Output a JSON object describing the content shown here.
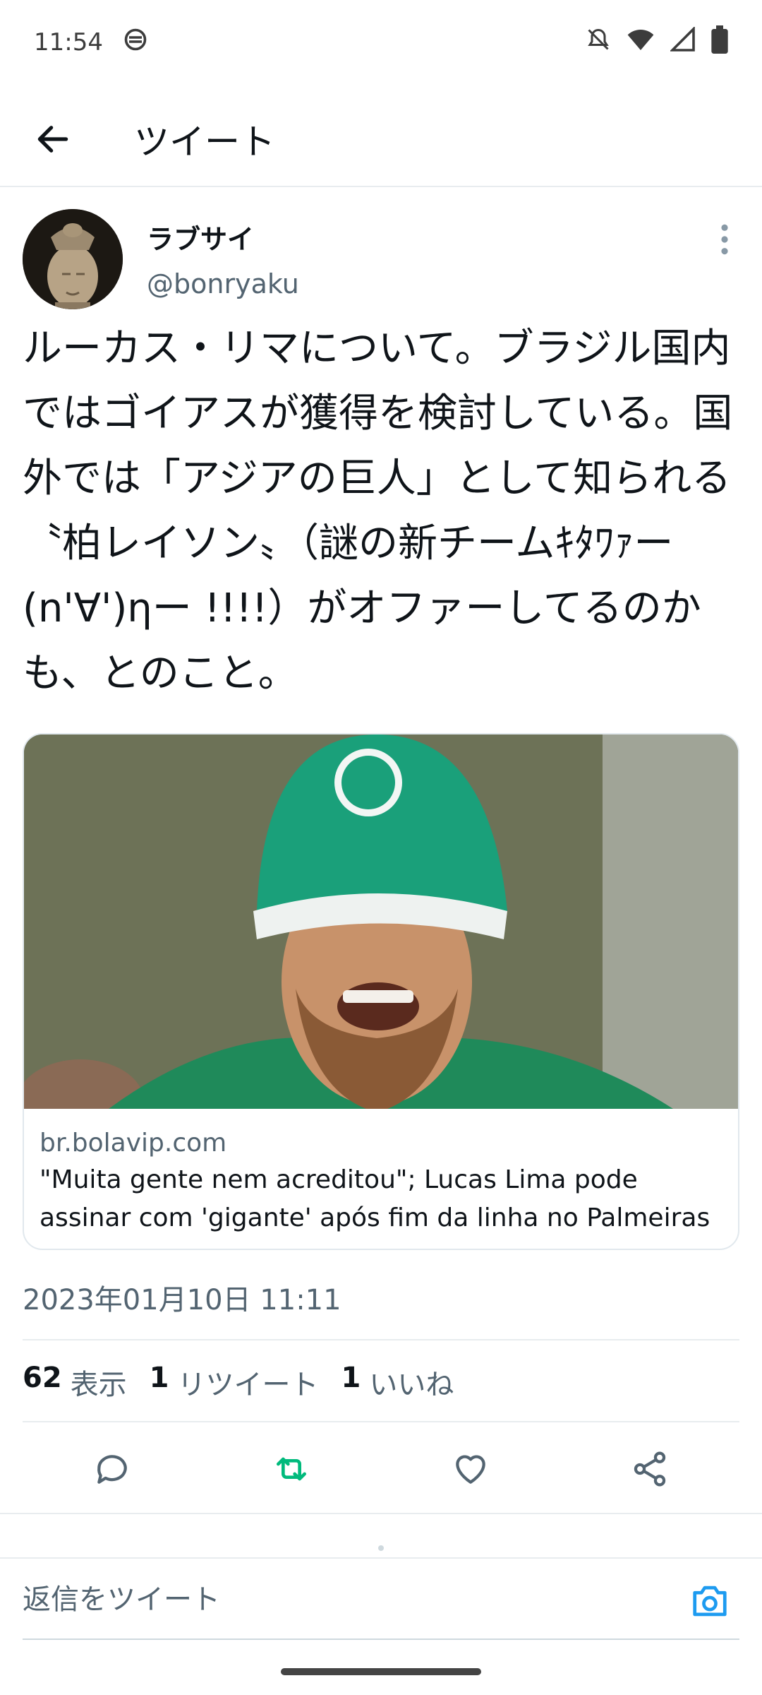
{
  "status_bar": {
    "time": "11:54",
    "icons": [
      "data-saver-icon",
      "notifications-off-icon",
      "wifi-icon",
      "cellular-icon",
      "battery-icon"
    ]
  },
  "header": {
    "title": "ツイート",
    "back_icon": "arrow-left-icon"
  },
  "tweet": {
    "author_name": "ラブサイ",
    "author_handle": "@bonryaku",
    "text": "ルーカス・リマについて。ブラジル国内ではゴイアスが獲得を検討している。国外では「アジアの巨人」として知られる〝柏レイソン〟（謎の新チームｷﾀﾜｧー(n'∀')ηー !!!!）がオファーしてるのかも、とのこと。",
    "timestamp": "2023年01月10日 11:11"
  },
  "card": {
    "domain": "br.bolavip.com",
    "title": "\"Muita gente nem acreditou\"; Lucas Lima pode assinar com 'gigante' após fim da linha no Palmeiras"
  },
  "stats": {
    "views_count": "62",
    "views_label": "表示",
    "retweets_count": "1",
    "retweets_label": "リツイート",
    "likes_count": "1",
    "likes_label": "いいね"
  },
  "actions": [
    "reply-icon",
    "retweet-icon",
    "like-icon",
    "share-icon"
  ],
  "reply": {
    "placeholder": "返信をツイート"
  },
  "colors": {
    "accent": "#1d9bf0",
    "retweet_green": "#00ba7c",
    "text_primary": "#0f1419",
    "text_secondary": "#536471"
  }
}
